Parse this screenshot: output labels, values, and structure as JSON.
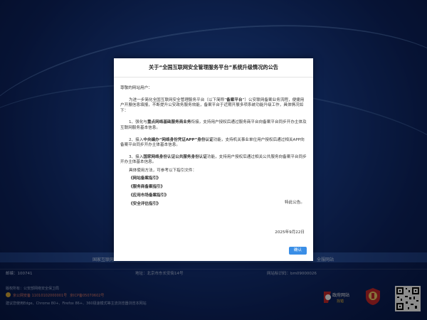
{
  "nav": {
    "left": "国家互联网",
    "right": "全服网站"
  },
  "footer": {
    "email": "邮编：100741",
    "address": "地址：北京市东长安街14号",
    "site_code": "网站标识码：bm09000026",
    "sponsor": "版权所有：公安部网络安全保卫局",
    "police_record": "京公网安备 11010102000001号",
    "icp": "京ICP备05070602号",
    "browser_tip": "建议您使用Edge、Chrome 80+、Firefox 86+、360极速模式等主流浏览器浏览本网站",
    "gov_logo_text_top": "政府网站",
    "gov_logo_text_bottom": "找错"
  },
  "dialog": {
    "title": "关于“全国互联网安全管理服务平台”系统升级情况的公告",
    "greeting": "尊敬的网站用户：",
    "intro_a": "为进一步简化全国互联网安全管理服务平台（以下简称“",
    "intro_bold": "备案平台",
    "intro_b": "”）公安联网备案业务流程，便捷用户开展信息填报，不断提升公安政务服务效能，备案平台于近期开展多项系统功能升级工作，具体情况如下：",
    "item1_a": "1、强化与",
    "item1_bold": "重点网络基础服务商业务",
    "item1_b": "衔接，支持用户授权后通过服务商平台向备案平台同步开办主体及互联网服务基本信息。",
    "item2_a": "2、接入",
    "item2_bold": "中央编办“网络身份凭证APP”身份认证",
    "item2_b": "功能，支持机关事业单位用户授权后通过相关APP向备案平台同步开办主体基本信息。",
    "item3_a": "3、接入",
    "item3_bold": "国家网络身份认证公共服务身份认证",
    "item3_b": "功能，支持用户授权后通过相关公共服务向备案平台同步开办主体基本信息。",
    "guide_intro": "具体使用方法，可参考以下指引文件：",
    "guides": [
      "《网站备案指引》",
      "《服务商备案指引》",
      "《应用市场备案指引》",
      "《安全评估指引》"
    ],
    "announce": "特此公告。",
    "date": "2025年9月22日",
    "confirm_label": "确认"
  },
  "colors": {
    "confirm_button": "#3a8ee6",
    "background_blue": "#1a3f8f",
    "overlay": "rgba(0,0,0,0.45)"
  }
}
